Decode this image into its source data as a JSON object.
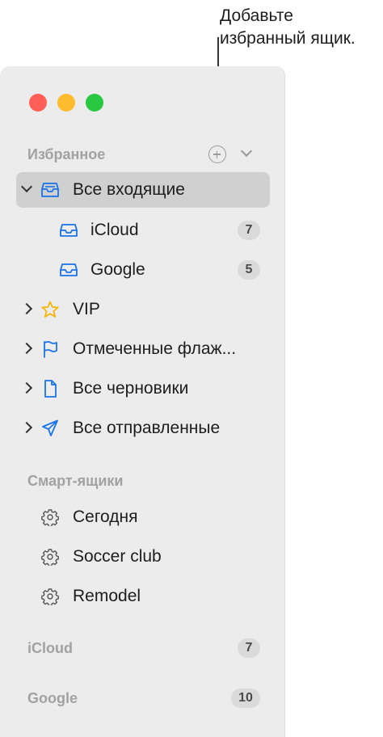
{
  "callout": {
    "line1": "Добавьте",
    "line2": "избранный ящик."
  },
  "favorites": {
    "label": "Избранное",
    "items": [
      {
        "label": "Все входящие",
        "icon": "inbox-tray-icon"
      },
      {
        "label": "iCloud",
        "icon": "inbox-tray-icon",
        "badge": "7"
      },
      {
        "label": "Google",
        "icon": "inbox-tray-icon",
        "badge": "5"
      },
      {
        "label": "VIP",
        "icon": "star-icon"
      },
      {
        "label": "Отмеченные флаж...",
        "icon": "flag-icon"
      },
      {
        "label": "Все черновики",
        "icon": "document-icon"
      },
      {
        "label": "Все отправленные",
        "icon": "paper-plane-icon"
      }
    ]
  },
  "smart": {
    "label": "Смарт-ящики",
    "items": [
      {
        "label": "Сегодня",
        "icon": "gear-icon"
      },
      {
        "label": "Soccer club",
        "icon": "gear-icon"
      },
      {
        "label": "Remodel",
        "icon": "gear-icon"
      }
    ]
  },
  "accounts": [
    {
      "label": "iCloud",
      "badge": "7"
    },
    {
      "label": "Google",
      "badge": "10"
    }
  ],
  "colors": {
    "accent": "#1a73e8",
    "star": "#f5b400",
    "selection": "#d0d0d0",
    "sidebar": "#ececec"
  }
}
